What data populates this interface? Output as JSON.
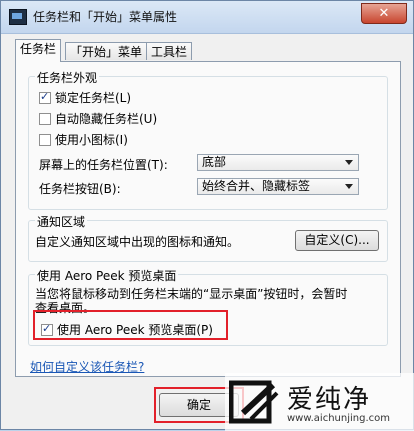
{
  "window": {
    "title": "任务栏和「开始」菜单属性",
    "close_label": "✕"
  },
  "tabs": [
    {
      "label": "任务栏"
    },
    {
      "label": "「开始」菜单"
    },
    {
      "label": "工具栏"
    }
  ],
  "appearance": {
    "title": "任务栏外观",
    "lock": {
      "label": "锁定任务栏(L)",
      "checked": true
    },
    "autohide": {
      "label": "自动隐藏任务栏(U)",
      "checked": false
    },
    "small_icons": {
      "label": "使用小图标(I)",
      "checked": false
    },
    "location": {
      "label": "屏幕上的任务栏位置(T):",
      "value": "底部"
    },
    "buttons": {
      "label": "任务栏按钮(B):",
      "value": "始终合并、隐藏标签"
    }
  },
  "notification": {
    "title": "通知区域",
    "description": "自定义通知区域中出现的图标和通知。",
    "customize_label": "自定义(C)..."
  },
  "aero_peek": {
    "title": "使用 Aero Peek 预览桌面",
    "desc_line1": "当您将鼠标移动到任务栏末端的“显示桌面”按钮时，会暂时",
    "desc_line2": "查看桌面。",
    "checkbox": {
      "label": "使用 Aero Peek 预览桌面(P)",
      "checked": true
    }
  },
  "help_link": "如何自定义该任务栏?",
  "ok_label": "确定",
  "watermark": {
    "brand": "爱纯净",
    "url": "www.aichunjing.com"
  },
  "colors": {
    "highlight": "#e2202a",
    "link": "#1a57b5"
  }
}
